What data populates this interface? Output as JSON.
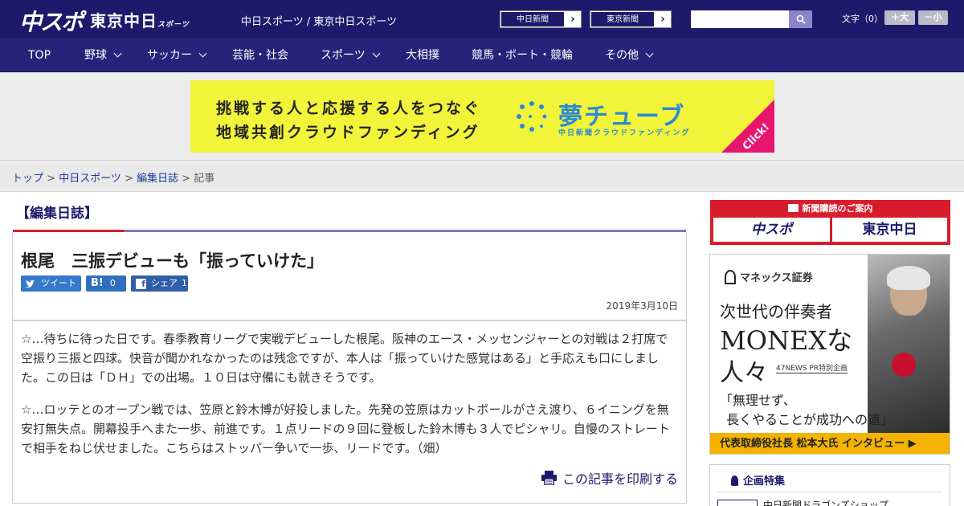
{
  "header": {
    "logo_main": "中スポ",
    "logo_sub": "東京中日",
    "logo_sub_small": "スポーツ",
    "site_title": "中日スポーツ / 東京中日スポーツ",
    "ext_links": [
      "中日新聞",
      "東京新聞"
    ],
    "fontsize_label": "文字（0）",
    "fontsize_plus": "＋大",
    "fontsize_minus": "－小"
  },
  "nav": {
    "items": [
      {
        "label": "TOP"
      },
      {
        "label": "野球"
      },
      {
        "label": "サッカー"
      },
      {
        "label": "芸能・社会"
      },
      {
        "label": "スポーツ"
      },
      {
        "label": "大相撲"
      },
      {
        "label": "競馬・ボート・競輪"
      },
      {
        "label": "その他"
      }
    ]
  },
  "banner": {
    "line1": "挑戦する人と応援する人をつなぐ",
    "line2": "地域共創クラウドファンディング",
    "brand": "夢チューブ",
    "brand_sub": "中日新聞クラウドファンディング",
    "click": "Click!"
  },
  "breadcrumb": {
    "items": [
      "トップ",
      "中日スポーツ",
      "編集日誌"
    ],
    "current": "記事",
    "sep": " > "
  },
  "article": {
    "section": "【編集日誌】",
    "headline": "根尾　三振デビューも「振っていけた」",
    "share": {
      "tweet": "ツイート",
      "hatena_count": "0",
      "facebook": "シェア",
      "facebook_count": "1"
    },
    "date": "2019年3月10日",
    "paragraphs": [
      "☆…待ちに待った日です。春季教育リーグで実戦デビューした根尾。阪神のエース・メッセンジャーとの対戦は２打席で空振り三振と四球。快音が聞かれなかったのは残念ですが、本人は「振っていけた感覚はある」と手応えも口にしました。この日は「ＤＨ」での出場。１０日は守備にも就きそうです。",
      "☆…ロッテとのオープン戦では、笠原と鈴木博が好投しました。先発の笠原はカットボールがさえ渡り、６イニングを無安打無失点。開幕投手へまた一歩、前進です。１点リードの９回に登板した鈴木博も３人でピシャリ。自慢のストレートで相手をねじ伏せました。こちらはストッパー争いで一歩、リードです。（畑）"
    ],
    "print": "この記事を印刷する"
  },
  "sidebar": {
    "subs_title": "新聞購読のご案内",
    "subs_logo_a": "中スポ",
    "subs_logo_b": "東京中日",
    "ad": {
      "brand": "マネックス証券",
      "t1": "次世代の伴奏者",
      "t2": "MONEXな",
      "t3": "人々",
      "pr": "47NEWS PR特別企画",
      "q1": "「無理せず、",
      "q2": "長くやることが成功への道」",
      "footer": "代表取締役社長 松本大氏 インタビュー ▶"
    },
    "feature_title": "企画特集",
    "feature_item": "中日新聞ドラゴンズショップ"
  }
}
